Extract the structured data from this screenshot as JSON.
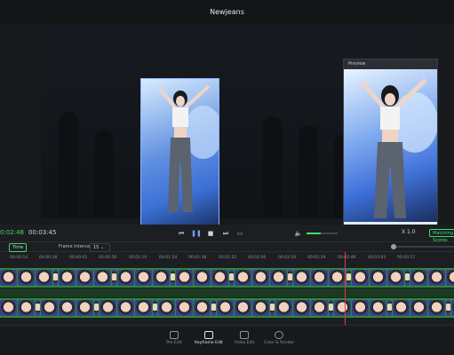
{
  "window": {
    "title": "Newjeans"
  },
  "preview": {
    "label": "Preview"
  },
  "playback": {
    "current_time": "0:02:48",
    "total_time": "00:03:45",
    "speed": "X 1.0",
    "mode_label": "Matching Scores",
    "controls": [
      "prev-frame",
      "pause",
      "stop",
      "next-frame",
      "loop"
    ]
  },
  "toolbar": {
    "time_label": "Time",
    "frame_interval_label": "Frame Interval",
    "frame_interval_value": "15"
  },
  "ruler": {
    "ticks": [
      "00:00:14",
      "00:00:28",
      "00:00:42",
      "00:00:56",
      "00:01:10",
      "00:01:24",
      "00:01:38",
      "00:01:52",
      "00:02:06",
      "00:02:20",
      "00:02:34",
      "00:02:48",
      "00:03:03",
      "00:03:17"
    ]
  },
  "bottom_nav": [
    {
      "label": "Pre Edit",
      "active": false
    },
    {
      "label": "Keyframe Edit",
      "active": true
    },
    {
      "label": "Video Edit",
      "active": false
    },
    {
      "label": "Color & Render",
      "active": false
    }
  ],
  "colors": {
    "accent": "#3ddc6a",
    "playhead": "#e23b3b",
    "track": "#2a8a3c",
    "selection": "#8ab4ff"
  }
}
